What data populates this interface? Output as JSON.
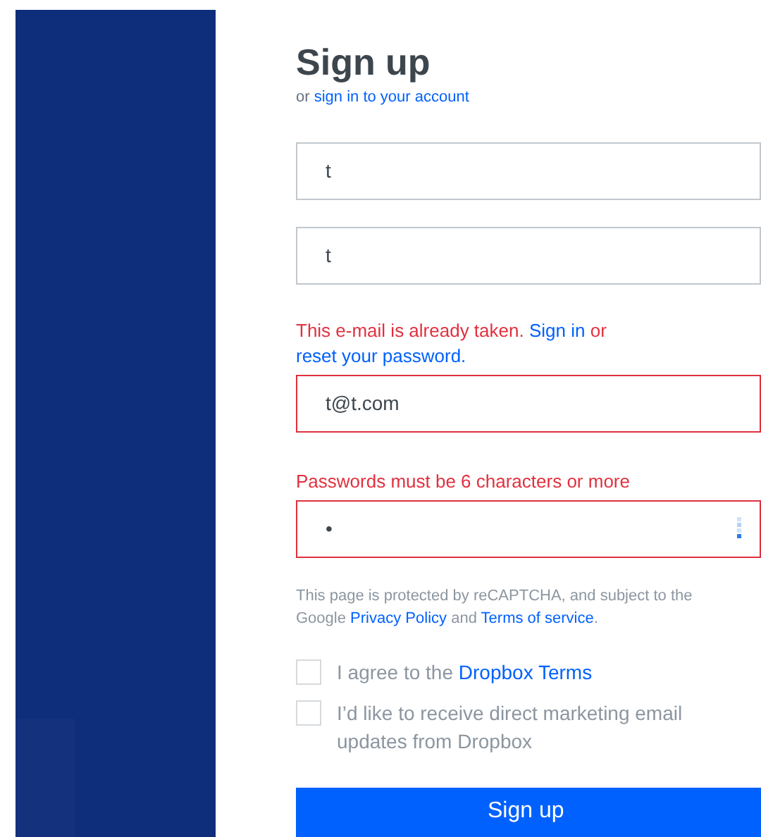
{
  "title": "Sign up",
  "subtitle": {
    "prefix": "or",
    "link": "sign in to your account"
  },
  "fields": [
    {
      "value": "t",
      "invalid": false
    },
    {
      "value": "t",
      "invalid": false
    },
    {
      "value": "t@t.com",
      "invalid": true,
      "error": {
        "text": "This e-mail is already taken.",
        "link1": "Sign in",
        "middle": "or",
        "link2": "reset your password."
      }
    },
    {
      "value": "•",
      "invalid": true,
      "password_icon": true,
      "error": {
        "text": "Passwords must be 6 characters or more"
      }
    }
  ],
  "recaptcha": {
    "prefix": "This page is protected by reCAPTCHA, and subject to the Google",
    "link1": "Privacy Policy",
    "middle": "and",
    "link2": "Terms of service",
    "suffix": "."
  },
  "checkboxes": [
    {
      "label": "I agree to the",
      "link": "Dropbox Terms",
      "checked": false
    },
    {
      "label": "I’d like to receive direct marketing email updates from Dropbox",
      "checked": false
    }
  ],
  "submit": "Sign up"
}
